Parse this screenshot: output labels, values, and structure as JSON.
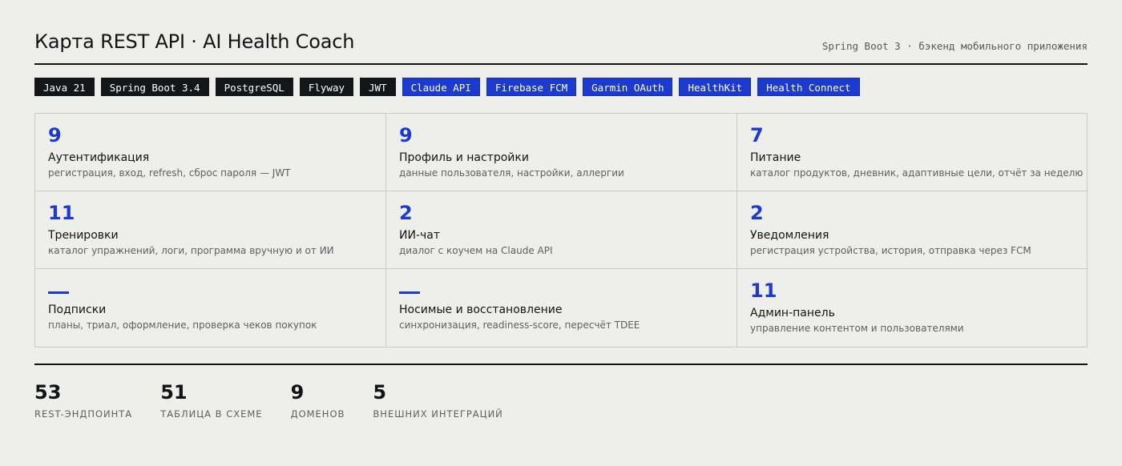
{
  "header": {
    "title": "Карта REST API · AI Health Coach",
    "subtitle": "Spring Boot 3 · бэкенд мобильного приложения"
  },
  "tags": [
    {
      "label": "Java 21",
      "style": "dark"
    },
    {
      "label": "Spring Boot 3.4",
      "style": "dark"
    },
    {
      "label": "PostgreSQL",
      "style": "dark"
    },
    {
      "label": "Flyway",
      "style": "dark"
    },
    {
      "label": "JWT",
      "style": "dark"
    },
    {
      "label": "Claude API",
      "style": "blue"
    },
    {
      "label": "Firebase FCM",
      "style": "blue"
    },
    {
      "label": "Garmin OAuth",
      "style": "blue"
    },
    {
      "label": "HealthKit",
      "style": "blue"
    },
    {
      "label": "Health Connect",
      "style": "blue"
    }
  ],
  "domains": [
    {
      "count": "9",
      "title": "Аутентификация",
      "desc": "регистрация, вход, refresh, сброс пароля — JWT"
    },
    {
      "count": "9",
      "title": "Профиль и настройки",
      "desc": "данные пользователя, настройки, аллергии"
    },
    {
      "count": "7",
      "title": "Питание",
      "desc": "каталог продуктов, дневник, адаптивные цели, отчёт за неделю"
    },
    {
      "count": "11",
      "title": "Тренировки",
      "desc": "каталог упражнений, логи, программа вручную и от ИИ"
    },
    {
      "count": "2",
      "title": "ИИ-чат",
      "desc": "диалог с коучем на Claude API"
    },
    {
      "count": "2",
      "title": "Уведомления",
      "desc": "регистрация устройства, история, отправка через FCM"
    },
    {
      "count": null,
      "title": "Подписки",
      "desc": "планы, триал, оформление, проверка чеков покупок"
    },
    {
      "count": null,
      "title": "Носимые и восстановление",
      "desc": "синхронизация, readiness-score, пересчёт TDEE"
    },
    {
      "count": "11",
      "title": "Админ-панель",
      "desc": "управление контентом и пользователями"
    }
  ],
  "stats": [
    {
      "value": "53",
      "label": "REST-эндпоинта"
    },
    {
      "value": "51",
      "label": "таблица в схеме"
    },
    {
      "value": "9",
      "label": "доменов"
    },
    {
      "value": "5",
      "label": "внешних интеграций"
    }
  ],
  "colors": {
    "accent": "#1c3ad0",
    "dark": "#121618",
    "background": "#eeefeb"
  }
}
